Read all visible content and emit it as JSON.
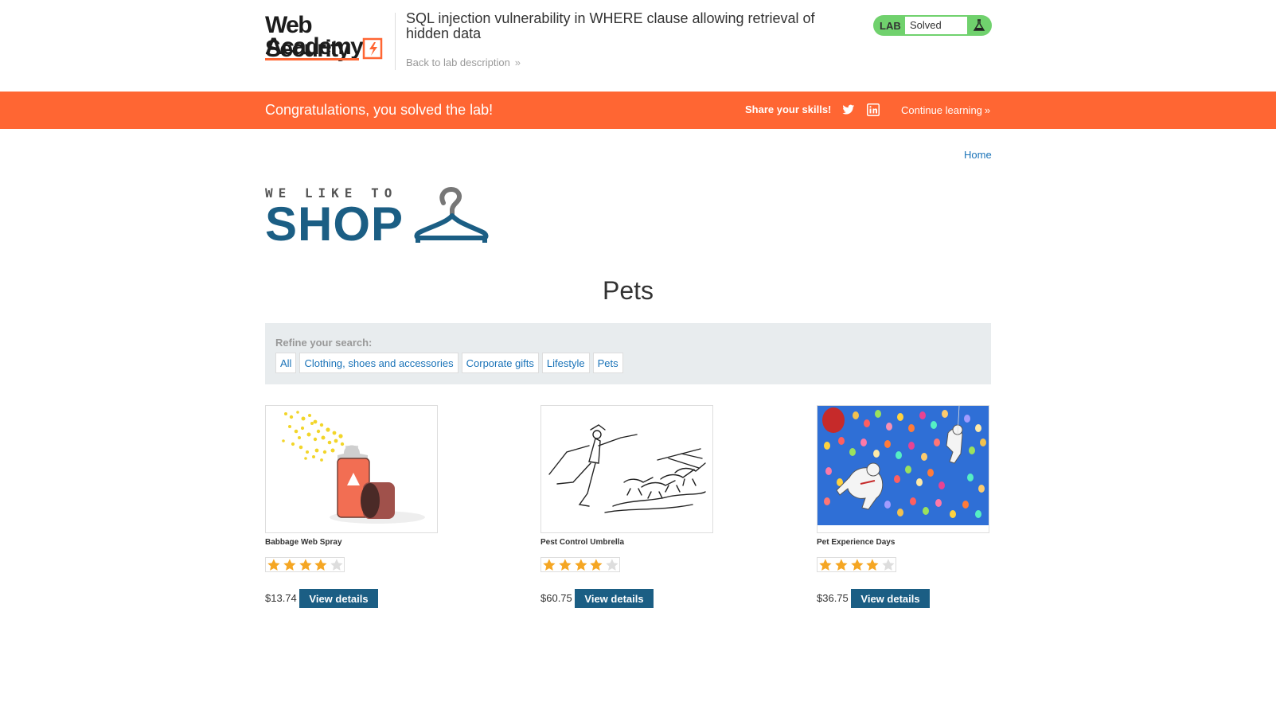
{
  "header": {
    "logo": {
      "line1": "Web Security",
      "line2": "Academy"
    },
    "lab_title": "SQL injection vulnerability in WHERE clause allowing retrieval of hidden data",
    "back_link": "Back to lab description",
    "lab_status": {
      "label": "LAB",
      "status": "Solved"
    }
  },
  "banner": {
    "message": "Congratulations, you solved the lab!",
    "share_label": "Share your skills!",
    "continue_label": "Continue learning"
  },
  "nav": {
    "home": "Home"
  },
  "shop_logo": {
    "tagline": "WE LIKE TO",
    "word": "SHOP"
  },
  "page": {
    "heading": "Pets"
  },
  "filters": {
    "title": "Refine your search:",
    "items": [
      "All",
      "Clothing, shoes and accessories",
      "Corporate gifts",
      "Lifestyle",
      "Pets"
    ]
  },
  "products": [
    {
      "name": "Babbage Web Spray",
      "rating": 4,
      "max_rating": 5,
      "price": "$13.74",
      "button": "View details",
      "image": "spray-can-image"
    },
    {
      "name": "Pest Control Umbrella",
      "rating": 4,
      "max_rating": 5,
      "price": "$60.75",
      "button": "View details",
      "image": "umbrella-sketch-image"
    },
    {
      "name": "Pet Experience Days",
      "rating": 4,
      "max_rating": 5,
      "price": "$36.75",
      "button": "View details",
      "image": "balloons-dogs-image"
    }
  ],
  "colors": {
    "banner": "#ff6633",
    "brand_blue": "#1b5e84",
    "link_blue": "#1a73b8",
    "lab_green": "#70d16d",
    "star_gold": "#f5a623",
    "filter_bg": "#e8ecee"
  }
}
